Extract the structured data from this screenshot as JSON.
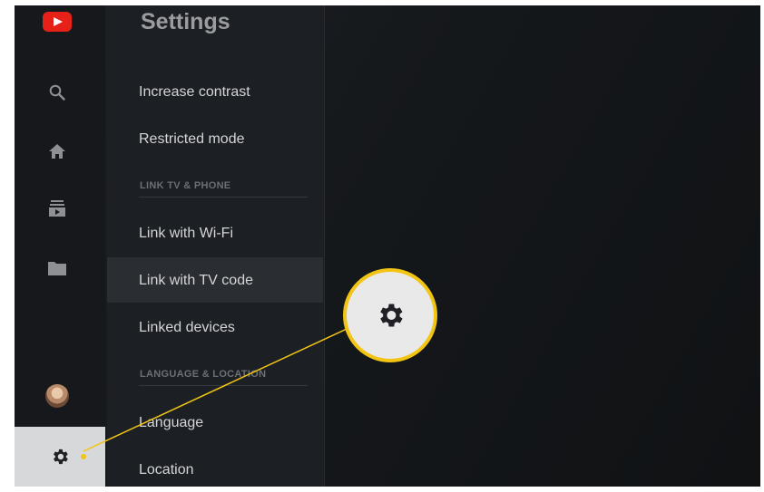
{
  "app": {
    "title": "Settings"
  },
  "rail": {
    "icons": [
      "youtube-logo",
      "search-icon",
      "home-icon",
      "subscriptions-icon",
      "library-icon",
      "account-avatar",
      "settings-icon"
    ]
  },
  "settings": {
    "items_top": [
      {
        "label": "Increase contrast"
      },
      {
        "label": "Restricted mode"
      }
    ],
    "section_link": "LINK TV & PHONE",
    "items_link": [
      {
        "label": "Link with Wi-Fi"
      },
      {
        "label": "Link with TV code"
      },
      {
        "label": "Linked devices"
      }
    ],
    "section_language": "LANGUAGE & LOCATION",
    "items_language": [
      {
        "label": "Language"
      },
      {
        "label": "Location"
      }
    ]
  },
  "colors": {
    "youtube_red": "#e62117",
    "callout_ring": "#f2c514",
    "selected_rail": "#d7d8d9"
  }
}
